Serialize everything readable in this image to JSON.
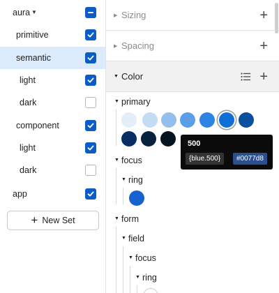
{
  "sets": {
    "items": [
      {
        "label": "aura",
        "state": "partial"
      },
      {
        "label": "primitive",
        "state": "checked"
      },
      {
        "label": "semantic",
        "state": "checked"
      },
      {
        "label": "light",
        "state": "checked"
      },
      {
        "label": "dark",
        "state": "unchecked"
      },
      {
        "label": "component",
        "state": "checked"
      },
      {
        "label": "light",
        "state": "checked"
      },
      {
        "label": "dark",
        "state": "unchecked"
      },
      {
        "label": "app",
        "state": "checked"
      }
    ],
    "new_set_label": "New Set"
  },
  "sections": {
    "sizing": "Sizing",
    "spacing": "Spacing",
    "color": "Color"
  },
  "tree": {
    "primary": "primary",
    "focus": "focus",
    "ring": "ring",
    "form": "form",
    "field": "field",
    "field_focus": "focus",
    "field_ring": "ring"
  },
  "colors": {
    "primary_swatches": [
      "#e4eef9",
      "#c4dcf3",
      "#94bfec",
      "#5b9fe6",
      "#2e84e5",
      "#0f6fd7",
      "#0b4f9f",
      "#082e63",
      "#07213f",
      "#06141f"
    ],
    "focus_ring": "#1662cf",
    "accent": "#0b5cc6",
    "selected_row": "#dcebfb"
  },
  "tooltip": {
    "title": "500",
    "reference": "{blue.500}",
    "hex": "#0077d8"
  }
}
